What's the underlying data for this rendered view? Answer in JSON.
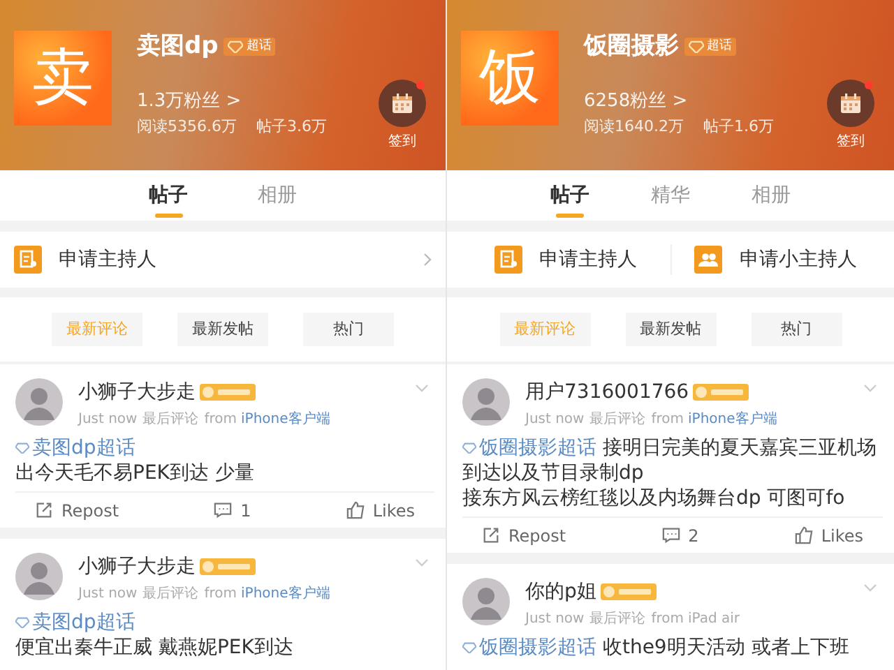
{
  "panels": [
    {
      "header": {
        "avatar_char": "卖",
        "name": "卖图dp",
        "badge": "超话",
        "fans": "1.3万粉丝 >",
        "stats": [
          "阅读5356.6万",
          "帖子3.6万"
        ],
        "checkin": "签到"
      },
      "tabs": [
        {
          "label": "帖子",
          "selected": true
        },
        {
          "label": "相册",
          "selected": false
        }
      ],
      "host_actions": [
        {
          "kind": "host",
          "label": "申请主持人"
        }
      ],
      "host_chevron": true,
      "sort_buttons": [
        {
          "label": "最新评论",
          "selected": true
        },
        {
          "label": "最新发帖",
          "selected": false
        },
        {
          "label": "热门",
          "selected": false
        }
      ],
      "posts": [
        {
          "user": "小狮子大步走",
          "time": "Just now",
          "action": "最后评论",
          "source_prefix": "from",
          "source": "iPhone客户端",
          "source_linked": true,
          "topic": "卖图dp超话",
          "topic_inline": false,
          "text": "出今天毛不易PEK到达 少量",
          "actions": {
            "repost": "Repost",
            "comments": "1",
            "likes": "Likes"
          }
        },
        {
          "user": "小狮子大步走",
          "time": "Just now",
          "action": "最后评论",
          "source_prefix": "from",
          "source": "iPhone客户端",
          "source_linked": true,
          "topic": "卖图dp超话",
          "topic_inline": false,
          "text": "便宜出秦牛正威 戴燕妮PEK到达"
        }
      ]
    },
    {
      "header": {
        "avatar_char": "饭",
        "name": "饭圈摄影",
        "badge": "超话",
        "fans": "6258粉丝 >",
        "stats": [
          "阅读1640.2万",
          "帖子1.6万"
        ],
        "checkin": "签到"
      },
      "tabs": [
        {
          "label": "帖子",
          "selected": true
        },
        {
          "label": "精华",
          "selected": false
        },
        {
          "label": "相册",
          "selected": false
        }
      ],
      "host_actions": [
        {
          "kind": "host",
          "label": "申请主持人"
        },
        {
          "kind": "subhost",
          "label": "申请小主持人"
        }
      ],
      "host_chevron": false,
      "sort_buttons": [
        {
          "label": "最新评论",
          "selected": true
        },
        {
          "label": "最新发帖",
          "selected": false
        },
        {
          "label": "热门",
          "selected": false
        }
      ],
      "posts": [
        {
          "user": "用户7316001766",
          "time": "Just now",
          "action": "最后评论",
          "source_prefix": "from",
          "source": "iPhone客户端",
          "source_linked": true,
          "topic": "饭圈摄影超话",
          "topic_inline": true,
          "text": "接明日完美的夏天嘉宾三亚机场到达以及节目录制dp\n接东方风云榜红毯以及内场舞台dp 可图可fo",
          "actions": {
            "repost": "Repost",
            "comments": "2",
            "likes": "Likes"
          }
        },
        {
          "user": "你的p姐",
          "time": "Just now",
          "action": "最后评论",
          "source_prefix": "from",
          "source": "iPad air",
          "source_linked": false,
          "topic": "饭圈摄影超话",
          "topic_inline": true,
          "text": "收the9明天活动 或者上下班"
        }
      ]
    }
  ]
}
